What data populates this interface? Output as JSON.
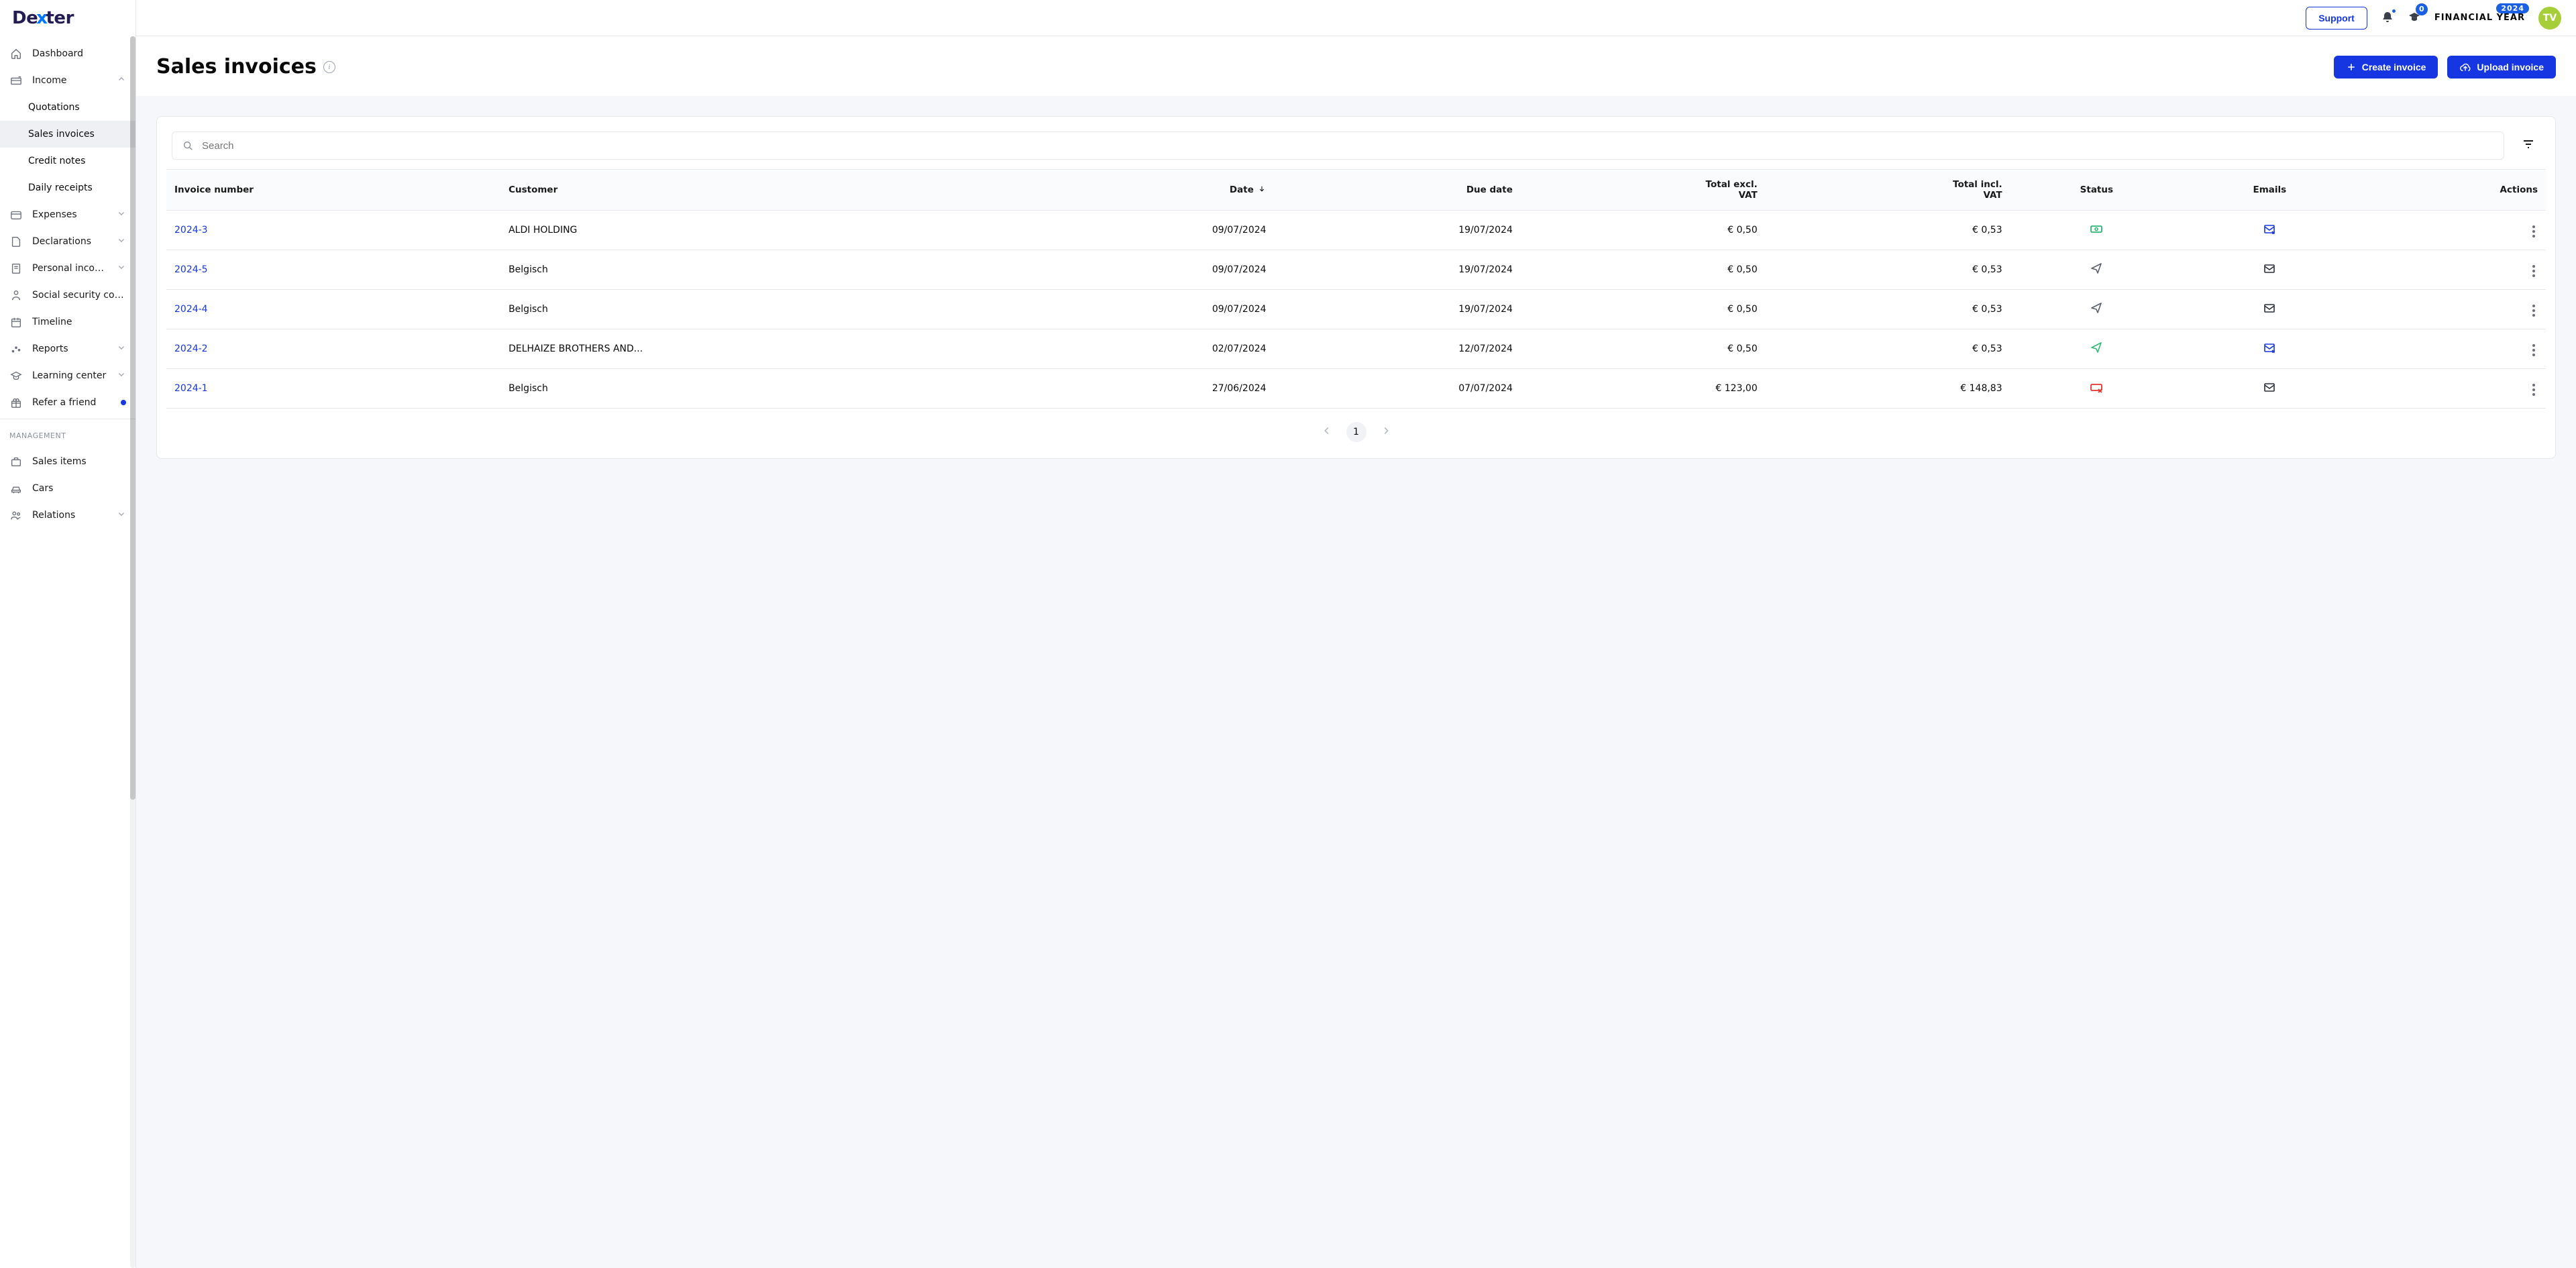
{
  "brand": {
    "part1": "De",
    "x": "x",
    "part2": "ter"
  },
  "topbar": {
    "support": "Support",
    "notif_count": "0",
    "fy_label": "FINANCIAL YEAR",
    "fy_year": "2024",
    "avatar": "TV"
  },
  "sidebar": {
    "items": [
      {
        "label": "Dashboard",
        "icon": "home"
      },
      {
        "label": "Income",
        "icon": "income",
        "expanded": true,
        "subs": [
          {
            "label": "Quotations"
          },
          {
            "label": "Sales invoices",
            "active": true
          },
          {
            "label": "Credit notes"
          },
          {
            "label": "Daily receipts"
          }
        ]
      },
      {
        "label": "Expenses",
        "icon": "card",
        "chev": true
      },
      {
        "label": "Declarations",
        "icon": "file",
        "chev": true
      },
      {
        "label": "Personal incom...",
        "icon": "doc",
        "chev": true
      },
      {
        "label": "Social security contr...",
        "icon": "person"
      },
      {
        "label": "Timeline",
        "icon": "calendar"
      },
      {
        "label": "Reports",
        "icon": "dots",
        "chev": true
      },
      {
        "label": "Learning center",
        "icon": "cap",
        "chev": true
      },
      {
        "label": "Refer a friend",
        "icon": "gift",
        "dot": true
      }
    ],
    "management_label": "MANAGEMENT",
    "management": [
      {
        "label": "Sales items",
        "icon": "briefcase"
      },
      {
        "label": "Cars",
        "icon": "car"
      },
      {
        "label": "Relations",
        "icon": "people",
        "chev": true
      }
    ]
  },
  "page": {
    "title": "Sales invoices",
    "create": "Create invoice",
    "upload": "Upload invoice",
    "search_ph": "Search"
  },
  "table": {
    "headers": {
      "invoice": "Invoice number",
      "customer": "Customer",
      "date": "Date",
      "due": "Due date",
      "excl": "Total excl. VAT",
      "incl": "Total incl. VAT",
      "status": "Status",
      "emails": "Emails",
      "actions": "Actions"
    },
    "rows": [
      {
        "num": "2024-3",
        "customer": "ALDI HOLDING",
        "date": "09/07/2024",
        "due": "19/07/2024",
        "excl": "€ 0,50",
        "incl": "€ 0,53",
        "status": "paid",
        "email": "mail-blue"
      },
      {
        "num": "2024-5",
        "customer": "Belgisch",
        "date": "09/07/2024",
        "due": "19/07/2024",
        "excl": "€ 0,50",
        "incl": "€ 0,53",
        "status": "sent",
        "email": "mail"
      },
      {
        "num": "2024-4",
        "customer": "Belgisch",
        "date": "09/07/2024",
        "due": "19/07/2024",
        "excl": "€ 0,50",
        "incl": "€ 0,53",
        "status": "sent",
        "email": "mail"
      },
      {
        "num": "2024-2",
        "customer": "DELHAIZE BROTHERS AND...",
        "date": "02/07/2024",
        "due": "12/07/2024",
        "excl": "€ 0,50",
        "incl": "€ 0,53",
        "status": "sent-green",
        "email": "mail-blue"
      },
      {
        "num": "2024-1",
        "customer": "Belgisch",
        "date": "27/06/2024",
        "due": "07/07/2024",
        "excl": "€ 123,00",
        "incl": "€ 148,83",
        "status": "overdue",
        "email": "mail"
      }
    ]
  },
  "pager": {
    "page": "1"
  }
}
